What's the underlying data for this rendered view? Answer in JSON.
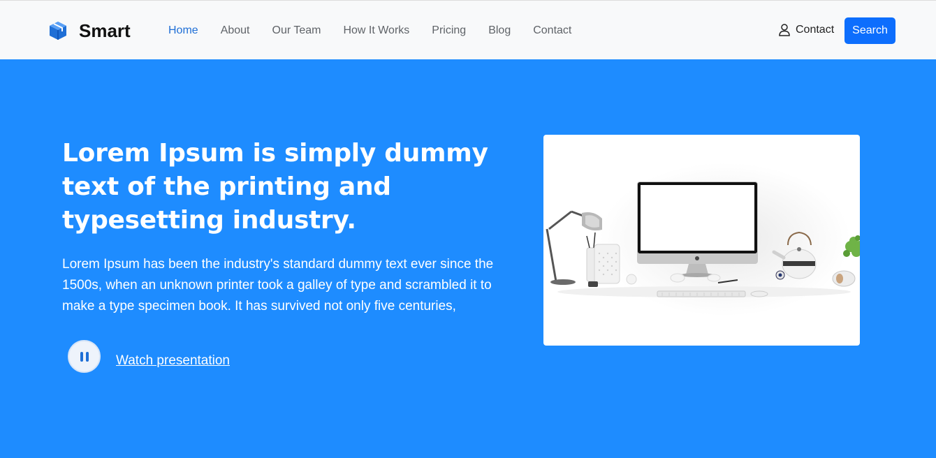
{
  "brand": {
    "name": "Smart",
    "icon": "cube-icon",
    "icon_color": "#1f6fd6"
  },
  "nav": {
    "items": [
      {
        "label": "Home",
        "active": true
      },
      {
        "label": "About",
        "active": false
      },
      {
        "label": "Our Team",
        "active": false
      },
      {
        "label": "How It Works",
        "active": false
      },
      {
        "label": "Pricing",
        "active": false
      },
      {
        "label": "Blog",
        "active": false
      },
      {
        "label": "Contact",
        "active": false
      }
    ],
    "contact_label": "Contact",
    "contact_icon": "user-icon",
    "search_label": "Search"
  },
  "hero": {
    "title": "Lorem Ipsum is simply dummy text of the printing and typesetting industry.",
    "description": "Lorem Ipsum has been the industry's standard dummy text ever since the 1500s, when an unknown printer took a galley of type and scrambled it to make a type specimen book. It has survived not only five centuries,",
    "play_icon": "pause-icon",
    "watch_label": "Watch presentation"
  },
  "colors": {
    "hero_background": "#1e8cff",
    "navbar_background": "#f8f9fa",
    "accent": "#0d6efd",
    "active_link": "#1f6fd6"
  }
}
